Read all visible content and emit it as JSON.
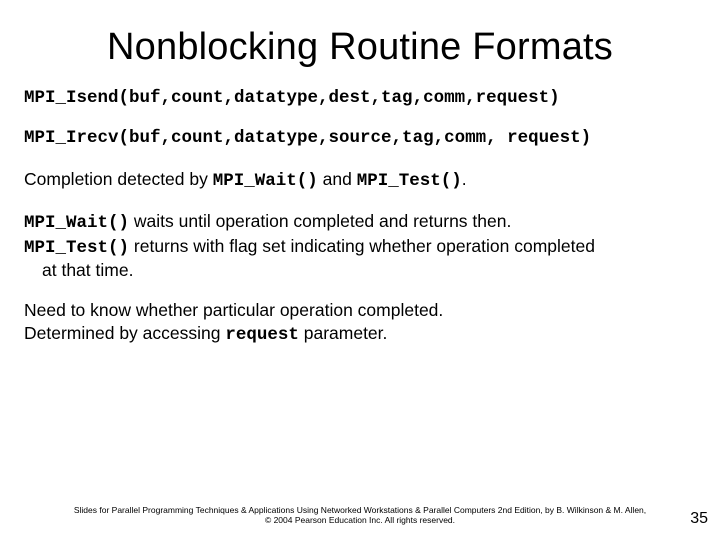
{
  "title": "Nonblocking Routine Formats",
  "code1": "MPI_Isend(buf,count,datatype,dest,tag,comm,request)",
  "code2": "MPI_Irecv(buf,count,datatype,source,tag,comm, request)",
  "line3_a": "Completion detected by ",
  "line3_b": "MPI_Wait()",
  "line3_c": " and ",
  "line3_d": "MPI_Test()",
  "line3_e": ".",
  "line4_a": "MPI_Wait()",
  "line4_b": " waits until operation completed and returns then.",
  "line5_a": "MPI_Test()",
  "line5_b": " returns with flag set indicating whether operation completed",
  "line5_c": "at that time.",
  "line6": "Need to know whether particular operation completed.",
  "line7_a": "Determined by accessing ",
  "line7_b": "request",
  "line7_c": " parameter.",
  "footer1": "Slides for Parallel Programming Techniques & Applications Using Networked Workstations & Parallel Computers 2nd Edition, by B. Wilkinson & M. Allen,",
  "footer2": "© 2004 Pearson Education Inc. All rights reserved.",
  "pagenum": "35"
}
